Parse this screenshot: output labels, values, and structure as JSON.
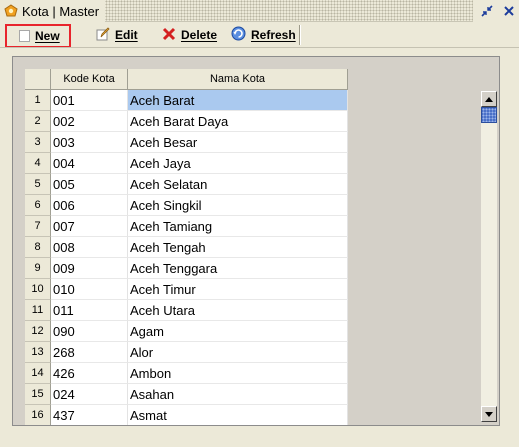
{
  "window": {
    "title": "Kota | Master"
  },
  "toolbar": {
    "new_label": "New",
    "edit_label": "Edit",
    "delete_label": "Delete",
    "refresh_label": "Refresh"
  },
  "grid": {
    "columns": [
      "Kode Kota",
      "Nama Kota"
    ],
    "selected_row": 1,
    "rows": [
      {
        "num": "1",
        "kode": "001",
        "nama": "Aceh Barat"
      },
      {
        "num": "2",
        "kode": "002",
        "nama": "Aceh Barat Daya"
      },
      {
        "num": "3",
        "kode": "003",
        "nama": "Aceh Besar"
      },
      {
        "num": "4",
        "kode": "004",
        "nama": "Aceh Jaya"
      },
      {
        "num": "5",
        "kode": "005",
        "nama": "Aceh Selatan"
      },
      {
        "num": "6",
        "kode": "006",
        "nama": "Aceh Singkil"
      },
      {
        "num": "7",
        "kode": "007",
        "nama": "Aceh Tamiang"
      },
      {
        "num": "8",
        "kode": "008",
        "nama": "Aceh Tengah"
      },
      {
        "num": "9",
        "kode": "009",
        "nama": "Aceh Tenggara"
      },
      {
        "num": "10",
        "kode": "010",
        "nama": "Aceh Timur"
      },
      {
        "num": "11",
        "kode": "011",
        "nama": "Aceh Utara"
      },
      {
        "num": "12",
        "kode": "090",
        "nama": "Agam"
      },
      {
        "num": "13",
        "kode": "268",
        "nama": "Alor"
      },
      {
        "num": "14",
        "kode": "426",
        "nama": "Ambon"
      },
      {
        "num": "15",
        "kode": "024",
        "nama": "Asahan"
      },
      {
        "num": "16",
        "kode": "437",
        "nama": "Asmat"
      }
    ]
  },
  "icons": {
    "app": "app-logo-icon",
    "restore": "restore-icon",
    "close": "close-icon",
    "new": "new-document-icon",
    "edit": "edit-pencil-icon",
    "delete": "delete-x-icon",
    "refresh": "refresh-icon"
  },
  "colors": {
    "highlight_border": "#e8242c",
    "selection": "#aac9ef",
    "scroll_thumb": "#4a70c8"
  }
}
